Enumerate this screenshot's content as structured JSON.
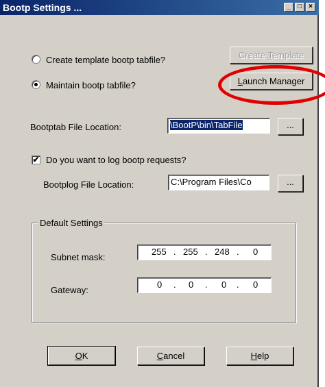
{
  "window": {
    "title": "Bootp Settings ..."
  },
  "titlebar_buttons": {
    "minimize": "_",
    "maximize": "□",
    "close": "×"
  },
  "options": {
    "create_template": {
      "label": "Create template bootp tabfile?",
      "selected": false
    },
    "maintain": {
      "label": "Maintain bootp tabfile?",
      "selected": true
    }
  },
  "buttons": {
    "create_template": {
      "pre": "Create ",
      "ul": "T",
      "post": "emplate",
      "enabled": false
    },
    "launch_manager": {
      "pre": "",
      "ul": "L",
      "post": "aunch Manager"
    },
    "browse_tab": "...",
    "browse_log": "...",
    "ok": {
      "ul": "O",
      "post": "K"
    },
    "cancel": {
      "ul": "C",
      "post": "ancel"
    },
    "help": {
      "ul": "H",
      "post": "elp"
    }
  },
  "bootptab": {
    "label": "Bootptab File Location:",
    "value": "\\BootP\\bin\\TabFile"
  },
  "log_requests": {
    "label": "Do you want to log bootp requests?",
    "checked": true
  },
  "bootplog": {
    "label": "Bootplog File Location:",
    "value": "C:\\Program Files\\Co"
  },
  "defaults": {
    "title": "Default Settings",
    "subnet": {
      "label": "Subnet mask:",
      "octets": [
        "255",
        "255",
        "248",
        "0"
      ]
    },
    "gateway": {
      "label": "Gateway:",
      "octets": [
        "0",
        "0",
        "0",
        "0"
      ]
    },
    "separator": "."
  },
  "colors": {
    "annotation": "#e00000",
    "titlebar": "#0a246a"
  }
}
